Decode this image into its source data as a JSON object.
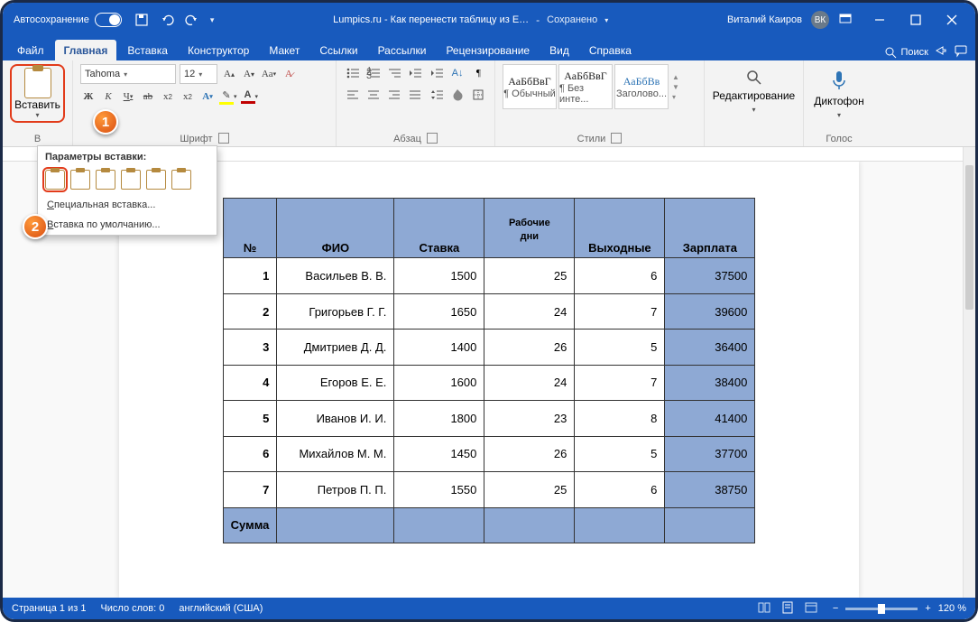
{
  "titlebar": {
    "autosave": "Автосохранение",
    "doc": "Lumpics.ru - Как перенести таблицу из E…",
    "saved": "Сохранено",
    "user": "Виталий Каиров",
    "initials": "ВК"
  },
  "tabs": {
    "items": [
      "Файл",
      "Главная",
      "Вставка",
      "Конструктор",
      "Макет",
      "Ссылки",
      "Рассылки",
      "Рецензирование",
      "Вид",
      "Справка"
    ],
    "active": 1,
    "search": "Поиск"
  },
  "ribbon": {
    "clipboard": {
      "paste": "Вставить",
      "group": "В"
    },
    "font": {
      "name": "Tahoma",
      "size": "12",
      "group": "Шрифт"
    },
    "paragraph": {
      "group": "Абзац"
    },
    "styles": {
      "items": [
        {
          "sample": "АаБбВвГ",
          "name": "¶ Обычный"
        },
        {
          "sample": "АаБбВвГ",
          "name": "¶ Без инте..."
        },
        {
          "sample": "АаБбВв",
          "name": "Заголово..."
        }
      ],
      "group": "Стили"
    },
    "editing": {
      "label": "Редактирование"
    },
    "voice": {
      "label": "Диктофон",
      "group": "Голос"
    }
  },
  "paste_menu": {
    "title": "Параметры вставки:",
    "special": "Специальная вставка...",
    "default": "Вставка по умолчанию...",
    "sp_u": "С",
    "df_u": "В"
  },
  "callouts": {
    "c1": "1",
    "c2": "2"
  },
  "table": {
    "headers": [
      "№",
      "ФИО",
      "Ставка",
      "Рабочие дни",
      "Выходные",
      "Зарплата"
    ],
    "header_days_l1": "Рабочие",
    "header_days_l2": "дни",
    "rows": [
      {
        "n": "1",
        "name": "Васильев В. В.",
        "rate": "1500",
        "days": "25",
        "off": "6",
        "salary": "37500"
      },
      {
        "n": "2",
        "name": "Григорьев Г. Г.",
        "rate": "1650",
        "days": "24",
        "off": "7",
        "salary": "39600"
      },
      {
        "n": "3",
        "name": "Дмитриев Д. Д.",
        "rate": "1400",
        "days": "26",
        "off": "5",
        "salary": "36400"
      },
      {
        "n": "4",
        "name": "Егоров Е. Е.",
        "rate": "1600",
        "days": "24",
        "off": "7",
        "salary": "38400"
      },
      {
        "n": "5",
        "name": "Иванов И. И.",
        "rate": "1800",
        "days": "23",
        "off": "8",
        "salary": "41400"
      },
      {
        "n": "6",
        "name": "Михайлов М. М.",
        "rate": "1450",
        "days": "26",
        "off": "5",
        "salary": "37700"
      },
      {
        "n": "7",
        "name": "Петров П. П.",
        "rate": "1550",
        "days": "25",
        "off": "6",
        "salary": "38750"
      }
    ],
    "sum": "Сумма"
  },
  "status": {
    "page": "Страница 1 из 1",
    "words": "Число слов: 0",
    "lang": "английский (США)",
    "zoom": "120 %"
  }
}
